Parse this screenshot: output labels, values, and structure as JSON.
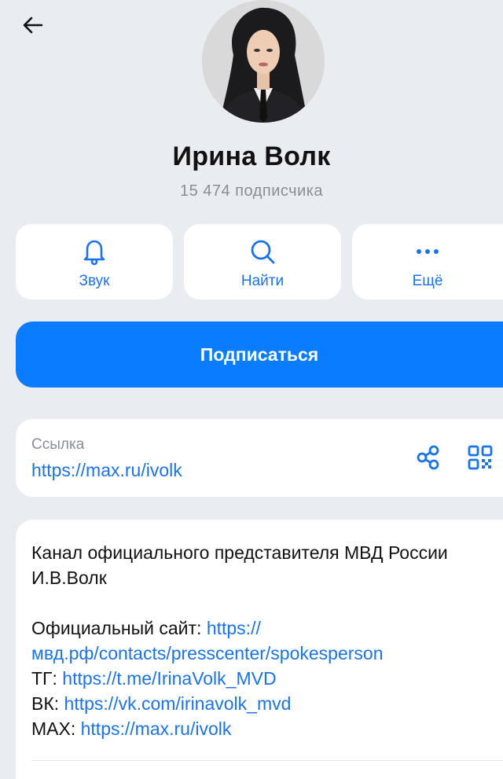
{
  "header": {
    "back_icon": "arrow-left-icon"
  },
  "channel": {
    "name": "Ирина Волк",
    "subscribers": "15 474 подписчика",
    "avatar_icon": "profile-photo"
  },
  "actions": [
    {
      "label": "Звук",
      "icon": "bell-icon"
    },
    {
      "label": "Найти",
      "icon": "search-icon"
    },
    {
      "label": "Ещё",
      "icon": "more-dots-icon"
    }
  ],
  "subscribe": {
    "label": "Подписаться"
  },
  "link": {
    "caption": "Ссылка",
    "url": "https://max.ru/ivolk",
    "share_icon": "share-icon",
    "qr_icon": "qr-code-icon"
  },
  "about": {
    "description": "Канал официального представителя МВД России И.В.Волк",
    "site_label": "Официальный сайт: ",
    "site_url": "https://мвд.рф/contacts/presscenter/spokesperson",
    "tg_label": "ТГ: ",
    "tg_url": "https://t.me/IrinaVolk_MVD",
    "vk_label": "ВК: ",
    "vk_url": "https://vk.com/irinavolk_mvd",
    "max_label": "MAX: ",
    "max_url": "https://max.ru/ivolk"
  },
  "colors": {
    "background": "#e9ecf1",
    "accent": "#0a7cff",
    "link": "#1a73e8",
    "muted": "#8a8d93"
  }
}
